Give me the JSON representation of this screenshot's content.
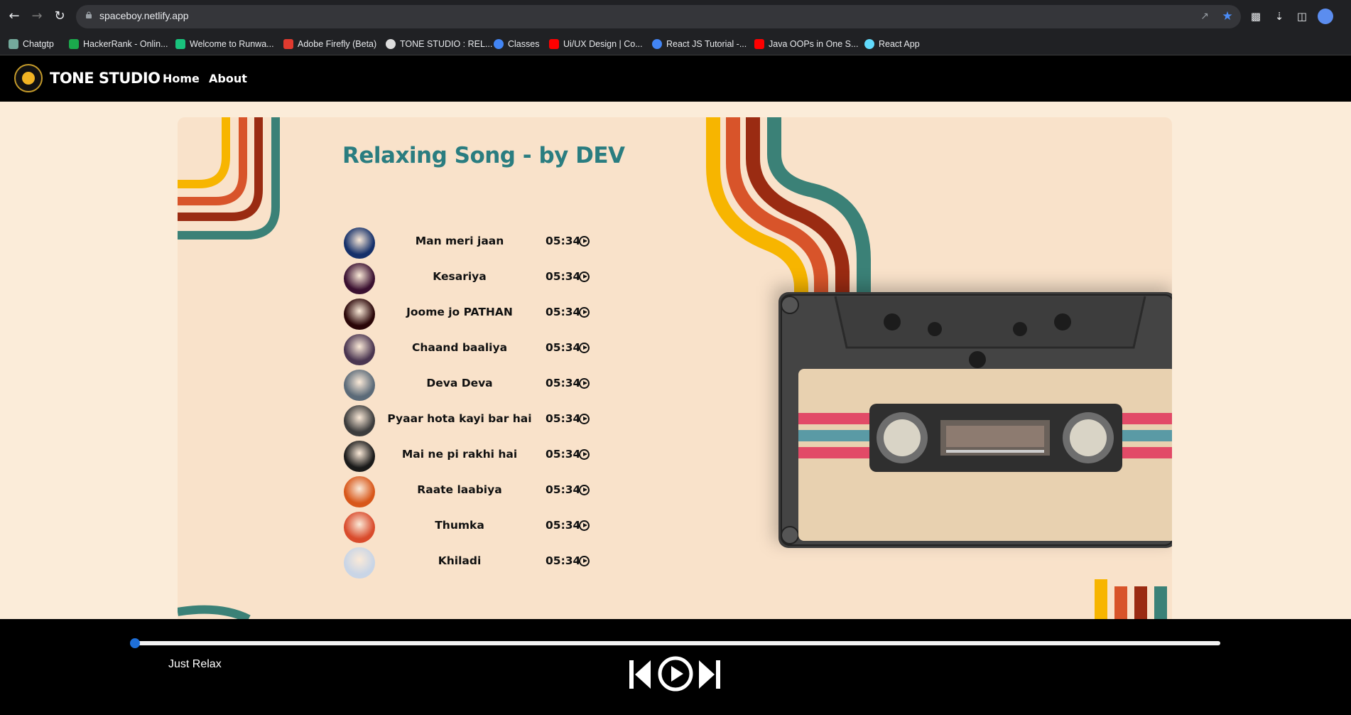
{
  "browser": {
    "url": "spaceboy.netlify.app",
    "bookmarks": [
      {
        "label": "Chatgtp",
        "color": "#74aa9c"
      },
      {
        "label": "HackerRank - Onlin...",
        "color": "#1ba94c"
      },
      {
        "label": "Welcome to Runwa...",
        "color": "#19c37d"
      },
      {
        "label": "Adobe Firefly (Beta)",
        "color": "#e03a2f"
      },
      {
        "label": "TONE STUDIO : REL...",
        "color": "#dddddd"
      },
      {
        "label": "Classes",
        "color": "#4285f4"
      },
      {
        "label": "Ui/UX Design | Co...",
        "color": "#ff0000"
      },
      {
        "label": "React JS Tutorial -...",
        "color": "#4285f4"
      },
      {
        "label": "Java OOPs in One S...",
        "color": "#ff0000"
      },
      {
        "label": "React App",
        "color": "#61dafb"
      }
    ]
  },
  "header": {
    "brand": "TONE STUDIO",
    "nav": [
      "Home",
      "About"
    ]
  },
  "playlist": {
    "title": "Relaxing Song - by DEV",
    "songs": [
      {
        "title": "Man meri jaan",
        "duration": "05:34",
        "art": "#15306a"
      },
      {
        "title": "Kesariya",
        "duration": "05:34",
        "art": "#3a1030"
      },
      {
        "title": "Joome jo PATHAN",
        "duration": "05:34",
        "art": "#2a0608"
      },
      {
        "title": "Chaand baaliya",
        "duration": "05:34",
        "art": "#4a3550"
      },
      {
        "title": "Deva Deva",
        "duration": "05:34",
        "art": "#5b6a78"
      },
      {
        "title": "Pyaar hota kayi bar hai",
        "duration": "05:34",
        "art": "#3c3c3c"
      },
      {
        "title": "Mai ne pi rakhi hai",
        "duration": "05:34",
        "art": "#1a1a1a"
      },
      {
        "title": "Raate laabiya",
        "duration": "05:34",
        "art": "#d8571a"
      },
      {
        "title": "Thumka",
        "duration": "05:34",
        "art": "#d94b2c"
      },
      {
        "title": "Khiladi",
        "duration": "05:34",
        "art": "#c9d5e6"
      }
    ]
  },
  "player": {
    "now_playing": "Just Relax",
    "progress": 0
  },
  "colors": {
    "accent": "#2a7d80",
    "stripe_yellow": "#f7b500",
    "stripe_orange": "#d8542a",
    "stripe_red": "#9a2b12",
    "stripe_teal": "#3b8177"
  }
}
